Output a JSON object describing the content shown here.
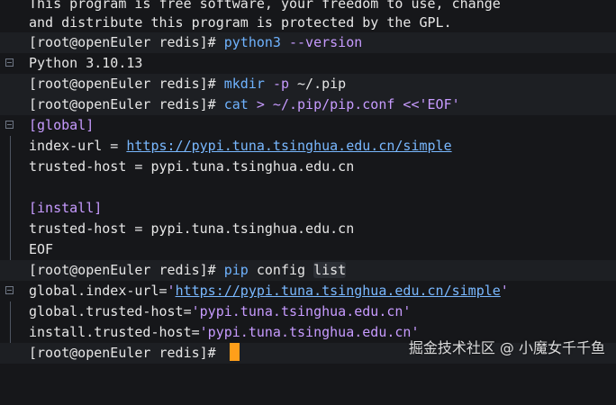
{
  "intro": {
    "line1": "This program is free software, your freedom to use, change",
    "line2": "and distribute this program is protected by the GPL."
  },
  "prompt": "[root@openEuler redis]# ",
  "cmd_python": {
    "name": "python3",
    "flag": "--version"
  },
  "python_output": "Python 3.10.13",
  "cmd_mkdir": {
    "name": "mkdir",
    "flag": "-p",
    "arg": "~/.pip"
  },
  "cmd_cat": {
    "name": "cat",
    "rest": "> ~/.pip/pip.conf <<'EOF'"
  },
  "conf": {
    "global_section": "[global]",
    "index_url_key": "index-url = ",
    "index_url_value": "https://pypi.tuna.tsinghua.edu.cn/simple",
    "trusted_host_1": "trusted-host = pypi.tuna.tsinghua.edu.cn",
    "install_section": "[install]",
    "trusted_host_2": "trusted-host = pypi.tuna.tsinghua.edu.cn",
    "eof": "EOF"
  },
  "cmd_pip": {
    "name": "pip",
    "word": "config",
    "arg": "list"
  },
  "pip_output": {
    "index_key": "global.index-url=",
    "index_q1": "'",
    "index_value": "https://pypi.tuna.tsinghua.edu.cn/simple",
    "index_q2": "'",
    "trusted_global": "global.trusted-host=",
    "trusted_global_value": "'pypi.tuna.tsinghua.edu.cn'",
    "trusted_install": "install.trusted-host=",
    "trusted_install_value": "'pypi.tuna.tsinghua.edu.cn'"
  },
  "watermark": "掘金技术社区 @ 小魔女千千鱼",
  "colors": {
    "background": "#16171a",
    "command": "#6fb3ff",
    "argument": "#c79bff",
    "cursor": "#ff9f1a"
  }
}
